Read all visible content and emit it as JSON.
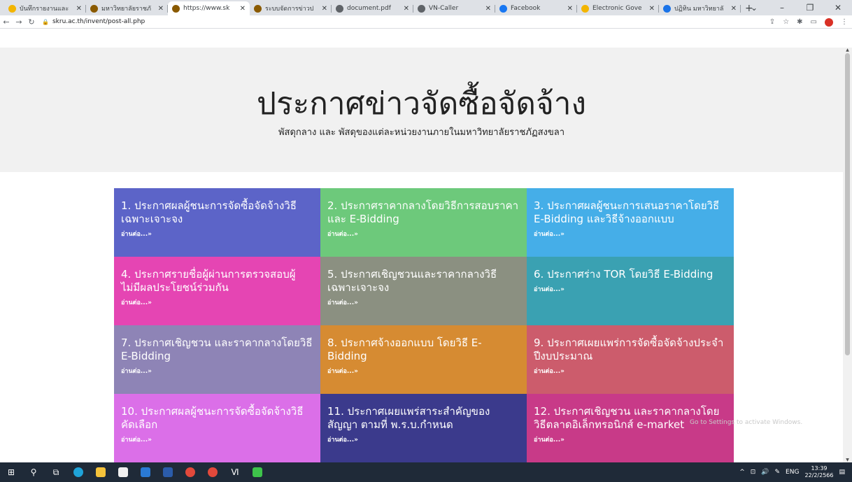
{
  "browser": {
    "tabs": [
      {
        "title": "บันทึกรายงานและ",
        "fav_color": "#f3b500",
        "active": false
      },
      {
        "title": "มหาวิทยาลัยราชภั",
        "fav_color": "#8a5a00",
        "active": false
      },
      {
        "title": "https://www.sk",
        "fav_color": "#8a5a00",
        "active": true
      },
      {
        "title": "ระบบจัดการข่าวป",
        "fav_color": "#8a5a00",
        "active": false
      },
      {
        "title": "document.pdf",
        "fav_color": "#5f6368",
        "active": false
      },
      {
        "title": "VN-Caller",
        "fav_color": "#5f6368",
        "active": false
      },
      {
        "title": "Facebook",
        "fav_color": "#1877f2",
        "active": false
      },
      {
        "title": "Electronic Gove",
        "fav_color": "#f3b500",
        "active": false
      },
      {
        "title": "ปฏิทิน มหาวิทยาลั",
        "fav_color": "#1a73e8",
        "active": false
      }
    ],
    "new_tab": "+",
    "url": "skru.ac.th/invent/post-all.php"
  },
  "hero": {
    "title": "ประกาศข่าวจัดซื้อจัดจ้าง",
    "subtitle": "พัสดุกลาง และ พัสดุของแต่ละหน่วยงานภายในมหาวิทยาลัยราชภัฏสงขลา"
  },
  "cards": [
    {
      "title": "1. ประกาศผลผู้ชนะการจัดซื้อจัดจ้างวิธีเฉพาะเจาะจง",
      "link": "อ่านต่อ...»",
      "color": "#5c64c8"
    },
    {
      "title": "2. ประกาศราคากลางโดยวิธีการสอบราคา และ E-Bidding",
      "link": "อ่านต่อ...»",
      "color": "#6dc97b"
    },
    {
      "title": "3. ประกาศผลผู้ชนะการเสนอราคาโดยวิธี E-Bidding และวิธีจ้างออกแบบ",
      "link": "อ่านต่อ...»",
      "color": "#45aee8"
    },
    {
      "title": "4. ประกาศรายชื่อผู้ผ่านการตรวจสอบผู้ไม่มีผลประโยชน์ร่วมกัน",
      "link": "อ่านต่อ...»",
      "color": "#e545b3"
    },
    {
      "title": "5. ประกาศเชิญชวนและราคากลางวิธีเฉพาะเจาะจง",
      "link": "อ่านต่อ...»",
      "color": "#8b9081"
    },
    {
      "title": "6. ประกาศร่าง TOR โดยวิธี E-Bidding",
      "link": "อ่านต่อ...»",
      "color": "#3aa1b2"
    },
    {
      "title": "7. ประกาศเชิญชวน และราคากลางโดยวิธี E-Bidding",
      "link": "อ่านต่อ...»",
      "color": "#8e84b6"
    },
    {
      "title": "8. ประกาศจ้างออกแบบ โดยวิธี E-Bidding",
      "link": "อ่านต่อ...»",
      "color": "#d68b32"
    },
    {
      "title": "9. ประกาศเผยแพร่การจัดซื้อจัดจ้างประจำปีงบประมาณ",
      "link": "อ่านต่อ...»",
      "color": "#cc5c6c"
    },
    {
      "title": "10. ประกาศผลผู้ชนะการจัดซื้อจัดจ้างวิธีคัดเลือก",
      "link": "อ่านต่อ...»",
      "color": "#db6fe8"
    },
    {
      "title": "11. ประกาศเผยแพร่สาระสำคัญของสัญญา ตามที่ พ.ร.บ.กำหนด",
      "link": "อ่านต่อ...»",
      "color": "#3b3a8c"
    },
    {
      "title": "12. ประกาศเชิญชวน และราคากลางโดยวิธีตลาดอิเล็กทรอนิกส์ e-market",
      "link": "อ่านต่อ...»",
      "color": "#c83a88"
    }
  ],
  "watermark": {
    "line1": "",
    "line2": "Go to Settings to activate Windows."
  },
  "taskbar": {
    "lang": "ENG",
    "time": "13:39",
    "date": "22/2/2566"
  }
}
